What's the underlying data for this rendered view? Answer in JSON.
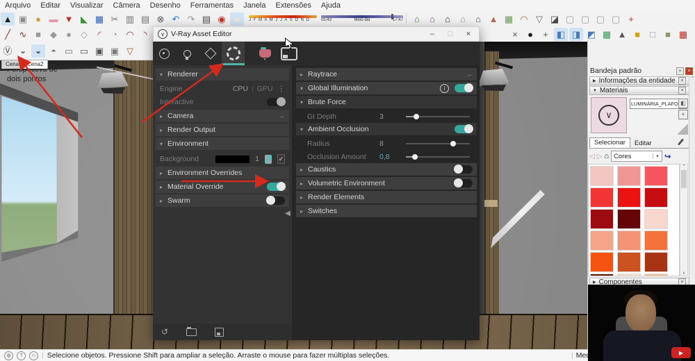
{
  "menu": [
    "Arquivo",
    "Editar",
    "Visualizar",
    "Câmera",
    "Desenho",
    "Ferramentas",
    "Janela",
    "Extensões",
    "Ajuda"
  ],
  "shadow": {
    "months": "J F M A M J J A S O N D",
    "start": "05:43",
    "noon": "Meio-dia",
    "end": "17:47"
  },
  "toolbars": {
    "row1": [
      {
        "name": "select-tool-icon",
        "glyph": "▲",
        "color": "#1a1a1a",
        "bg": "#cfe3f5"
      },
      {
        "name": "make-component-icon",
        "glyph": "▣",
        "color": "#8a8a8a"
      },
      {
        "name": "paint-bucket-icon",
        "glyph": "●",
        "color": "#c9a23a"
      },
      {
        "name": "eraser-icon",
        "glyph": "▬",
        "color": "#e598a6"
      },
      {
        "name": "add-location-icon",
        "glyph": "▼",
        "color": "#c03028"
      },
      {
        "name": "open-model-icon",
        "glyph": "◣",
        "color": "#3f8f3f"
      },
      {
        "name": "save-icon",
        "glyph": "▦",
        "color": "#2f5fb5"
      },
      {
        "name": "cut-icon",
        "glyph": "✂",
        "color": "#707070"
      },
      {
        "name": "copy-icon",
        "glyph": "▥",
        "color": "#707070"
      },
      {
        "name": "paste-icon",
        "glyph": "▤",
        "color": "#707070"
      },
      {
        "name": "delete-icon",
        "glyph": "⊗",
        "color": "#5a5a5a"
      },
      {
        "name": "undo-icon",
        "glyph": "↶",
        "color": "#2f6fc5"
      },
      {
        "name": "redo-icon",
        "glyph": "↷",
        "color": "#9a9a9a"
      },
      {
        "name": "print-icon",
        "glyph": "▤",
        "color": "#4a4a4a"
      },
      {
        "name": "model-info-icon",
        "glyph": "◉",
        "color": "#c03028"
      },
      {
        "name": "shadows-toggle-icon",
        "glyph": "■",
        "color": "#e8e4da",
        "bg": "#cfe3f5"
      }
    ],
    "row1_right": [
      {
        "name": "orbit-house-icon",
        "glyph": "⌂",
        "color": "#557a55"
      },
      {
        "name": "look-around-icon",
        "glyph": "⌂",
        "color": "#6a6a6a"
      },
      {
        "name": "front-view-icon",
        "glyph": "⌂",
        "color": "#2a2a2a"
      },
      {
        "name": "back-view-icon",
        "glyph": "⌂",
        "color": "#8a8a8a"
      },
      {
        "name": "iso-view-icon",
        "glyph": "⌂",
        "color": "#4a4a4a"
      },
      {
        "name": "sandbox-from-contours-icon",
        "glyph": "▲",
        "color": "#b06a4a"
      },
      {
        "name": "sandbox-from-scratch-icon",
        "glyph": "▦",
        "color": "#6a9a5a"
      },
      {
        "name": "smoove-icon",
        "glyph": "◠",
        "color": "#9a6a4a"
      },
      {
        "name": "stamp-icon",
        "glyph": "▽",
        "color": "#6a6a6a"
      },
      {
        "name": "drape-icon",
        "glyph": "◪",
        "color": "#444444"
      },
      {
        "name": "paste-in-place-icon",
        "glyph": "▢",
        "color": "#9a9aa5"
      },
      {
        "name": "select-all-icon",
        "glyph": "▢",
        "color": "#9a9aa5"
      },
      {
        "name": "select-none-icon",
        "glyph": "▢",
        "color": "#9a9aa5"
      },
      {
        "name": "invert-selection-icon",
        "glyph": "▢",
        "color": "#9a9aa5"
      },
      {
        "name": "zoom-extents-icon",
        "glyph": "+",
        "color": "#c03028"
      }
    ],
    "row2_left": [
      {
        "name": "line-tool-icon",
        "glyph": "╱",
        "color": "#8a2a2a"
      },
      {
        "name": "freehand-tool-icon",
        "glyph": "∿",
        "color": "#8a2a2a"
      },
      {
        "name": "rectangle-tool-icon",
        "glyph": "■",
        "color": "#9a9a9a"
      },
      {
        "name": "rotated-rectangle-tool-icon",
        "glyph": "◆",
        "color": "#9a9a9a"
      },
      {
        "name": "circle-tool-icon",
        "glyph": "●",
        "color": "#9a9a9a"
      },
      {
        "name": "polygon-tool-icon",
        "glyph": "◇",
        "color": "#9a9a9a"
      },
      {
        "name": "arc-tool-icon",
        "glyph": "◜",
        "color": "#8a2a2a"
      },
      {
        "name": "pie-tool-icon",
        "glyph": "◔",
        "color": "#9a9a9a"
      },
      {
        "name": "two-point-arc-tool-icon",
        "glyph": "◠",
        "color": "#8a2a2a"
      },
      {
        "name": "three-point-arc-tool-icon",
        "glyph": "◝",
        "color": "#8a2a2a"
      }
    ],
    "row2_right": [
      {
        "name": "close-toolbar-icon",
        "glyph": "×",
        "color": "#555555"
      },
      {
        "name": "sphere-tool-icon",
        "glyph": "●",
        "color": "#1a1a1a"
      },
      {
        "name": "axes-tool-icon",
        "glyph": "+",
        "color": "#555555"
      },
      {
        "name": "section-plane-icon",
        "glyph": "◧",
        "color": "#4a7ab5",
        "bg": "#cfe3f5"
      },
      {
        "name": "section-display-icon",
        "glyph": "◨",
        "color": "#4a7ab5",
        "bg": "#cfe3f5"
      },
      {
        "name": "section-cut-icon",
        "glyph": "◩",
        "color": "#4a7ab5"
      },
      {
        "name": "gradient-material-icon",
        "glyph": "▦",
        "color": "#3a9a5a"
      },
      {
        "name": "select-texture-icon",
        "glyph": "▲",
        "color": "#555555"
      },
      {
        "name": "style-shaded-icon",
        "glyph": "■",
        "color": "#d4a017"
      },
      {
        "name": "style-hidden-line-icon",
        "glyph": "□",
        "color": "#8a9ab5"
      },
      {
        "name": "style-monochrome-icon",
        "glyph": "■",
        "color": "#8a9a6a"
      },
      {
        "name": "layout-export-icon",
        "glyph": "▦",
        "color": "#c03028"
      }
    ],
    "vray_row": [
      {
        "name": "vray-logo-icon",
        "glyph": "Ⓥ",
        "color": "#3a3a3a"
      },
      {
        "name": "render-icon",
        "glyph": "◒",
        "color": "#777777"
      },
      {
        "name": "render-interactive-icon",
        "glyph": "◒",
        "color": "#555577",
        "bg": "#cfe3f5"
      },
      {
        "name": "render-viewport-icon",
        "glyph": "◓",
        "color": "#777777"
      },
      {
        "name": "viewport-render-icon",
        "glyph": "▭",
        "color": "#777777"
      },
      {
        "name": "frame-buffer-icon",
        "glyph": "▭",
        "color": "#555555"
      },
      {
        "name": "batch-render-icon",
        "glyph": "▣",
        "color": "#555555"
      },
      {
        "name": "lock-icon",
        "glyph": "▣",
        "color": "#777777"
      },
      {
        "name": "funnel-icon",
        "glyph": "▽",
        "color": "#a0622d"
      }
    ]
  },
  "scene_tabs": {
    "tab1": "Cena1",
    "tab2": "Cena2"
  },
  "viewport": {
    "label_line1": "Perspectiva de",
    "label_line2": "dois pontos"
  },
  "vray_editor": {
    "title": "V-Ray Asset Editor",
    "logo_glyph": "∨",
    "controls": {
      "minimize": "–",
      "maximize": "□",
      "close": "×"
    },
    "left": {
      "renderer": "Renderer",
      "engine": "Engine",
      "cpu": "CPU",
      "gpu": "GPU",
      "interactive": "Interactive",
      "camera": "Camera",
      "render_output": "Render Output",
      "environment": "Environment",
      "background": "Background",
      "background_value": "1",
      "environment_overrides": "Environment Overrides",
      "material_override": "Material Override",
      "swarm": "Swarm"
    },
    "right": {
      "raytrace": "Raytrace",
      "global_illumination": "Global Illumination",
      "brute_force": "Brute Force",
      "gi_depth_label": "GI Depth",
      "gi_depth_value": "3",
      "ambient_occlusion": "Ambient Occlusion",
      "radius_label": "Radius",
      "radius_value": "8",
      "occlusion_label": "Occlusion Amount",
      "occlusion_value": "0,8",
      "caustics": "Caustics",
      "volumetric": "Volumetric Environment",
      "render_elements": "Render Elements",
      "switches": "Switches"
    }
  },
  "tray": {
    "title": "Bandeja padrão",
    "entity_info": "Informações da entidade",
    "materials": "Materiais",
    "material_name": "LUMINÁRIA_PLAFON_ACES",
    "tab_select": "Selecionar",
    "tab_edit": "Editar",
    "collection": "Cores",
    "components": "Componentes",
    "colors": [
      "#f2c5c2",
      "#f09694",
      "#f4555e",
      "#f23532",
      "#ec1212",
      "#c60d11",
      "#9d0a0f",
      "#650508",
      "#f8d7ce",
      "#f4a488",
      "#f49376",
      "#f4733b",
      "#f4540f",
      "#cc5221",
      "#a93415",
      "#6b1f0a",
      "#f7e3c8",
      "#f8c496"
    ]
  },
  "statusbar": {
    "message": "Selecione objetos. Pressione Shift para ampliar a seleção. Arraste o mouse para fazer múltiplas seleções.",
    "measure": "Medi"
  },
  "accent": {
    "teal": "#45b6ab",
    "red_arrow": "#d42a1e"
  }
}
